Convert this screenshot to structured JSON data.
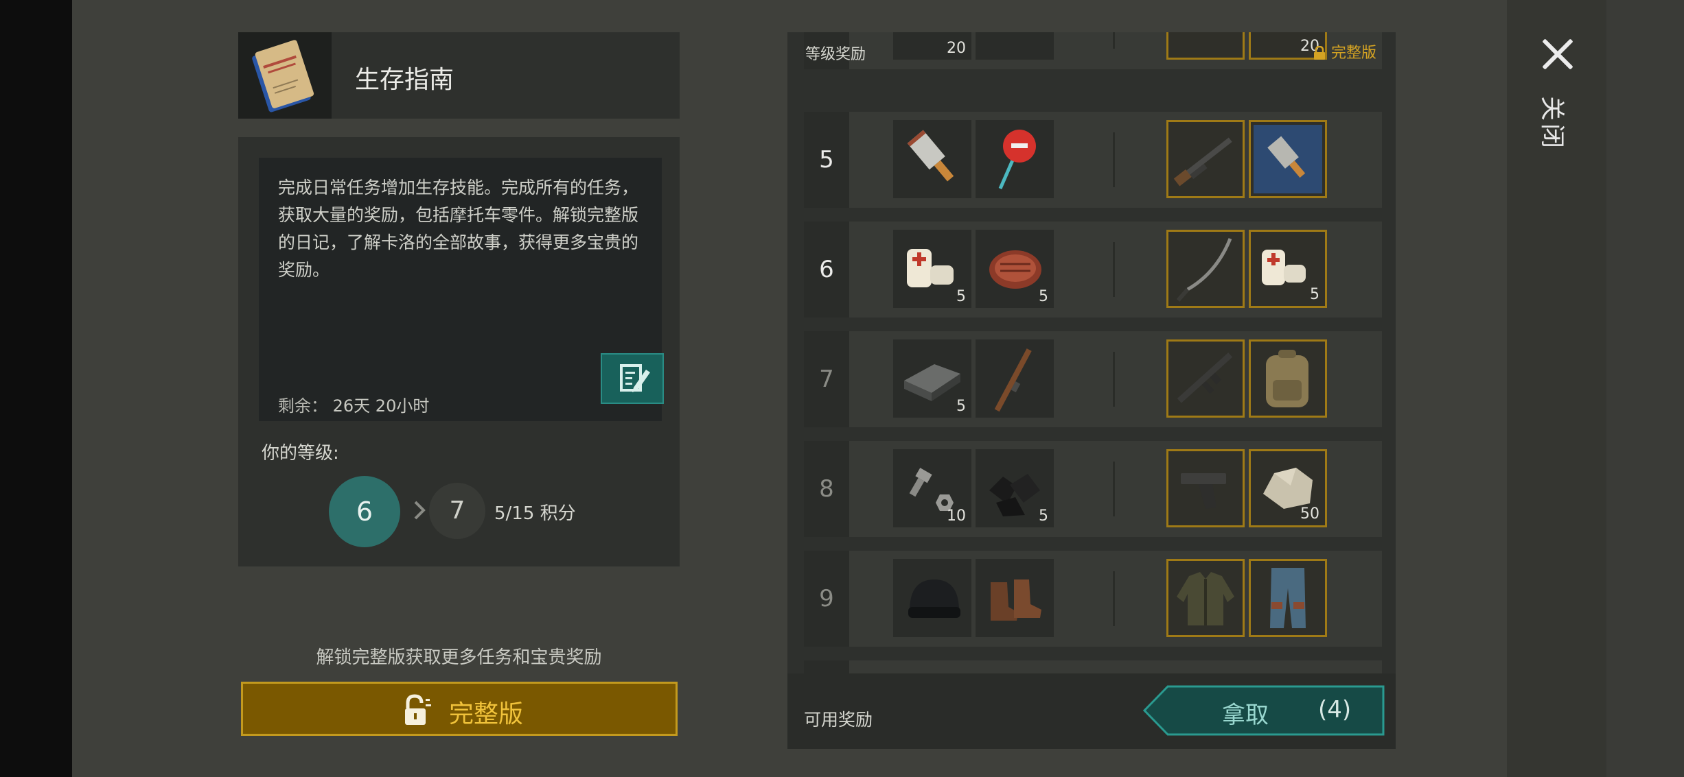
{
  "close": {
    "label": "关闭"
  },
  "guide": {
    "title": "生存指南",
    "description": "完成日常任务增加生存技能。完成所有的任务，获取大量的奖励，包括摩托车零件。解锁完整版的日记，了解卡洛的全部故事，获得更多宝贵的奖励。",
    "remaining_label": "剩余：",
    "remaining_value": "26天 20小时",
    "level_label": "你的等级:",
    "current_level": "6",
    "next_level": "7",
    "points": "5/15 积分",
    "unlock_tip": "解锁完整版获取更多任务和宝贵奖励",
    "full_version_label": "完整版"
  },
  "rewards": {
    "title": "等级奖励",
    "premium_label": "完整版",
    "available_label": "可用奖励",
    "claim_label": "拿取",
    "claim_count": "(4)",
    "partial_top_row": {
      "free": [
        "",
        "20"
      ],
      "premium": [
        "",
        "20"
      ]
    },
    "rows": [
      {
        "level": "5",
        "free": [
          {
            "icon": "cleaver-icon",
            "qty": ""
          },
          {
            "icon": "stop-sign-icon",
            "qty": ""
          }
        ],
        "premium": [
          {
            "icon": "shotgun-icon",
            "qty": ""
          },
          {
            "icon": "blueprint-cleaver-icon",
            "qty": ""
          }
        ]
      },
      {
        "level": "6",
        "free": [
          {
            "icon": "bandage-icon",
            "qty": "5"
          },
          {
            "icon": "steak-icon",
            "qty": "5"
          }
        ],
        "premium": [
          {
            "icon": "katana-icon",
            "qty": ""
          },
          {
            "icon": "bandage-icon",
            "qty": "5"
          }
        ]
      },
      {
        "level": "7",
        "free": [
          {
            "icon": "iron-bar-icon",
            "qty": "5"
          },
          {
            "icon": "rifle-icon",
            "qty": ""
          }
        ],
        "premium": [
          {
            "icon": "assault-rifle-icon",
            "qty": ""
          },
          {
            "icon": "backpack-icon",
            "qty": ""
          }
        ]
      },
      {
        "level": "8",
        "free": [
          {
            "icon": "bolt-nut-icon",
            "qty": "10"
          },
          {
            "icon": "coal-icon",
            "qty": "5"
          }
        ],
        "premium": [
          {
            "icon": "pistol-icon",
            "qty": ""
          },
          {
            "icon": "stone-icon",
            "qty": "50"
          }
        ]
      },
      {
        "level": "9",
        "free": [
          {
            "icon": "beanie-icon",
            "qty": ""
          },
          {
            "icon": "boots-icon",
            "qty": ""
          }
        ],
        "premium": [
          {
            "icon": "jacket-icon",
            "qty": ""
          },
          {
            "icon": "pants-icon",
            "qty": ""
          }
        ]
      }
    ]
  },
  "colors": {
    "teal": "#2d6f6a",
    "gold": "#d4a323",
    "premium_border": "#9f7a16",
    "panel": "#2e302d"
  }
}
